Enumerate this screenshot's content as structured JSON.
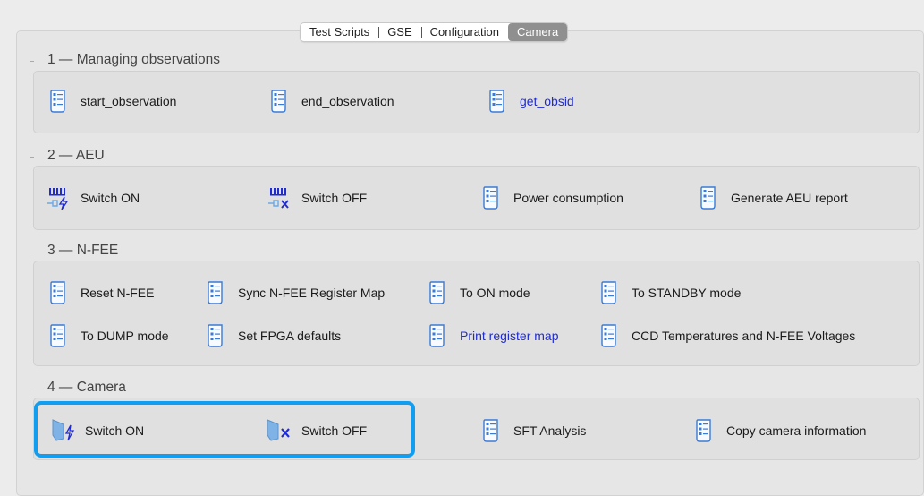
{
  "tabs": [
    {
      "label": "Test Scripts",
      "active": false
    },
    {
      "label": "GSE",
      "active": false
    },
    {
      "label": "Configuration",
      "active": false
    },
    {
      "label": "Camera",
      "active": true
    }
  ],
  "sections": {
    "s1": {
      "title": "1 — Managing observations",
      "items": [
        {
          "label": "start_observation",
          "icon": "script-icon"
        },
        {
          "label": "end_observation",
          "icon": "script-icon"
        },
        {
          "label": "get_obsid",
          "icon": "script-icon",
          "link": true
        }
      ]
    },
    "s2": {
      "title": "2 — AEU",
      "items": [
        {
          "label": "Switch ON",
          "icon": "aeu-power-on-icon"
        },
        {
          "label": "Switch OFF",
          "icon": "aeu-power-off-icon"
        },
        {
          "label": "Power consumption",
          "icon": "script-icon"
        },
        {
          "label": "Generate AEU report",
          "icon": "script-icon"
        }
      ]
    },
    "s3": {
      "title": "3 — N-FEE",
      "items": [
        {
          "label": "Reset N-FEE",
          "icon": "script-icon"
        },
        {
          "label": "Sync N-FEE Register Map",
          "icon": "script-icon"
        },
        {
          "label": "To ON mode",
          "icon": "script-icon"
        },
        {
          "label": "To STANDBY mode",
          "icon": "script-icon"
        },
        {
          "label": "To DUMP mode",
          "icon": "script-icon"
        },
        {
          "label": "Set FPGA defaults",
          "icon": "script-icon"
        },
        {
          "label": "Print register map",
          "icon": "script-icon",
          "link": true
        },
        {
          "label": "CCD Temperatures and N-FEE Voltages",
          "icon": "script-icon"
        }
      ]
    },
    "s4": {
      "title": "4 — Camera",
      "items": [
        {
          "label": "Switch ON",
          "icon": "camera-power-on-icon"
        },
        {
          "label": "Switch OFF",
          "icon": "camera-power-off-icon"
        },
        {
          "label": "SFT Analysis",
          "icon": "script-icon"
        },
        {
          "label": "Copy camera information",
          "icon": "script-icon"
        }
      ]
    }
  },
  "colors": {
    "link": "#1f2bd6",
    "highlight": "#129ef0",
    "icon_blue": "#3a7bd5"
  }
}
